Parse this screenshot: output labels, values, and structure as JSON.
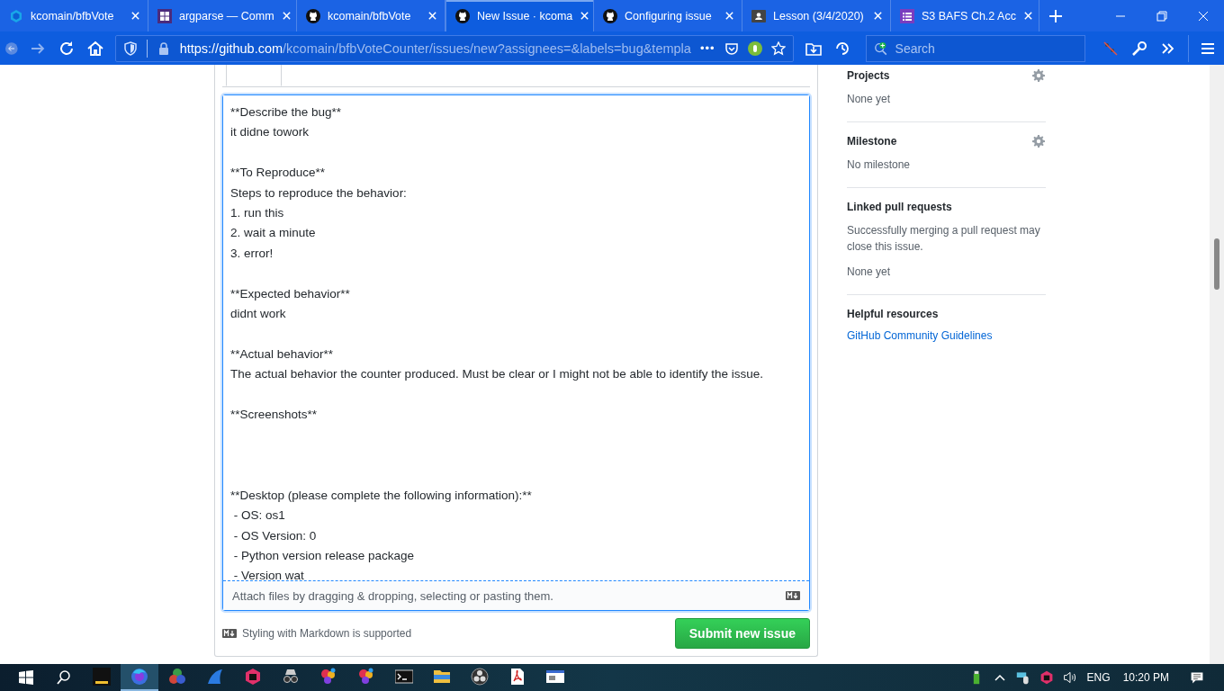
{
  "browser": {
    "tabs": [
      {
        "title": "kcomain/bfbVote",
        "kind": "cube",
        "selected": false
      },
      {
        "title": "argparse — Comm",
        "kind": "grid",
        "selected": false
      },
      {
        "title": "kcomain/bfbVote",
        "kind": "octocat",
        "selected": false
      },
      {
        "title": "New Issue · kcoma",
        "kind": "octocat",
        "selected": true
      },
      {
        "title": "Configuring issue",
        "kind": "octocat",
        "selected": false
      },
      {
        "title": "Lesson (3/4/2020)",
        "kind": "contact",
        "selected": false
      },
      {
        "title": "S3 BAFS Ch.2 Acc",
        "kind": "list",
        "selected": false
      }
    ],
    "url_host": "https://github.com",
    "url_path": "/kcomain/bfbVoteCounter/issues/new?assignees=&labels=bug&templa",
    "more": "•••",
    "search_placeholder": "Search"
  },
  "editor": {
    "value": "**Describe the bug**\nit didne towork\n\n**To Reproduce**\nSteps to reproduce the behavior:\n1. run this\n2. wait a minute\n3. error!\n\n**Expected behavior**\ndidnt work\n\n**Actual behavior**\nThe actual behavior the counter produced. Must be clear or I might not be able to identify the issue.\n\n**Screenshots**\n\n\n\n**Desktop (please complete the following information):**\n - OS: os1\n - OS Version: 0\n - Python version release package\n - Version wat",
    "attach_hint": "Attach files by dragging & dropping, selecting or pasting them.",
    "markdown_note": "Styling with Markdown is supported",
    "submit": "Submit new issue"
  },
  "sidebar": [
    {
      "heading": "Projects",
      "gear": true,
      "texts": [
        "None yet"
      ]
    },
    {
      "heading": "Milestone",
      "gear": true,
      "texts": [
        "No milestone"
      ]
    },
    {
      "heading": "Linked pull requests",
      "gear": false,
      "texts": [
        "Successfully merging a pull request may close this issue.",
        "None yet"
      ]
    },
    {
      "heading": "Helpful resources",
      "gear": false,
      "link": "GitHub Community Guidelines"
    }
  ],
  "taskbar": {
    "lang": "ENG",
    "clock": "10:20 PM"
  }
}
